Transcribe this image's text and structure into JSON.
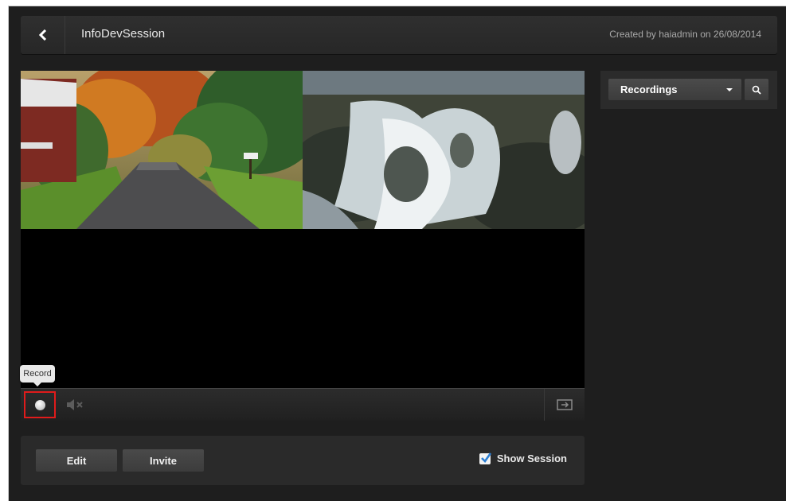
{
  "header": {
    "title": "InfoDevSession",
    "created_by": "Created by haiadmin on 26/08/2014"
  },
  "player": {
    "tooltip": "Record"
  },
  "actions": {
    "edit_label": "Edit",
    "invite_label": "Invite",
    "show_session_label": "Show Session",
    "show_session_checked": true
  },
  "sidebar": {
    "dropdown_selected": "Recordings"
  },
  "colors": {
    "record_highlight": "#e01b1b",
    "checkbox_check": "#2d7fd3"
  }
}
